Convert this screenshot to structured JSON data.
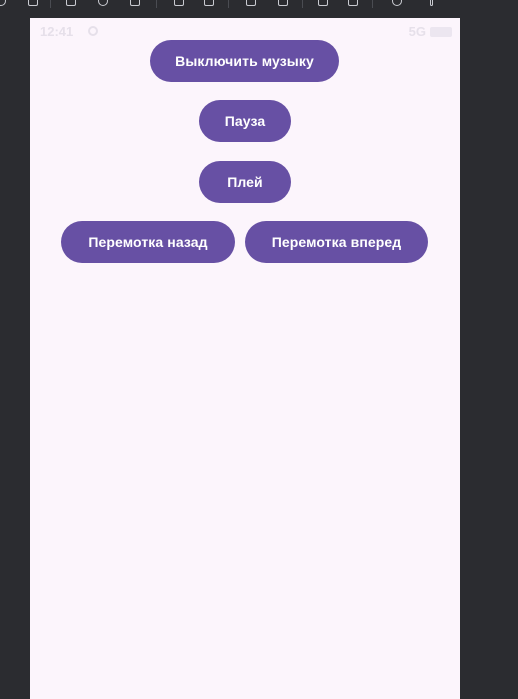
{
  "status_bar": {
    "time": "12:41",
    "network": "5G"
  },
  "buttons": {
    "mute_label": "Выключить музыку",
    "pause_label": "Пауза",
    "play_label": "Плей",
    "rewind_label": "Перемотка назад",
    "forward_label": "Перемотка вперед"
  },
  "colors": {
    "button_bg": "#6750a4",
    "button_text": "#ffffff",
    "screen_bg": "#fcf5fc",
    "ide_bg": "#2b2c30"
  },
  "icons": [
    "settings-icon",
    "battery-icon"
  ]
}
